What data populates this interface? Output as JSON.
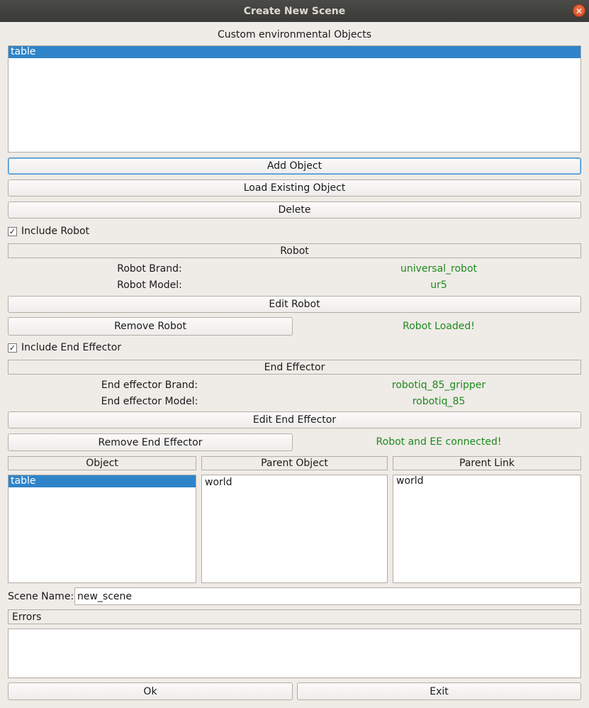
{
  "window": {
    "title": "Create New Scene"
  },
  "custom_objects": {
    "title": "Custom environmental Objects",
    "items": [
      "table"
    ]
  },
  "buttons": {
    "add_object": "Add Object",
    "load_existing_object": "Load Existing Object",
    "delete": "Delete",
    "edit_robot": "Edit Robot",
    "remove_robot": "Remove Robot",
    "edit_end_effector": "Edit End Effector",
    "remove_end_effector": "Remove End Effector",
    "ok": "Ok",
    "exit": "Exit"
  },
  "robot": {
    "include_label": "Include Robot",
    "include_checked": true,
    "header": "Robot",
    "brand_label": "Robot Brand:",
    "brand_value": "universal_robot",
    "model_label": "Robot Model:",
    "model_value": "ur5",
    "status": "Robot Loaded!"
  },
  "end_effector": {
    "include_label": "Include End Effector",
    "include_checked": true,
    "header": "End Effector",
    "brand_label": "End effector Brand:",
    "brand_value": "robotiq_85_gripper",
    "model_label": "End effector Model:",
    "model_value": "robotiq_85",
    "status": "Robot and EE connected!"
  },
  "relations": {
    "object_header": "Object",
    "parent_object_header": "Parent Object",
    "parent_link_header": "Parent Link",
    "objects": [
      "table"
    ],
    "parent_objects": [
      "world"
    ],
    "parent_links": [
      "world"
    ]
  },
  "scene": {
    "name_label": "Scene Name:",
    "name_value": "new_scene"
  },
  "errors": {
    "header": "Errors"
  },
  "colors": {
    "selection": "#2f84c9",
    "status_green": "#1d8a1d",
    "titlebar": "#3c3b37",
    "close_button": "#e5562b"
  },
  "icons": {
    "close": "close-icon",
    "check": "checkmark-icon"
  }
}
